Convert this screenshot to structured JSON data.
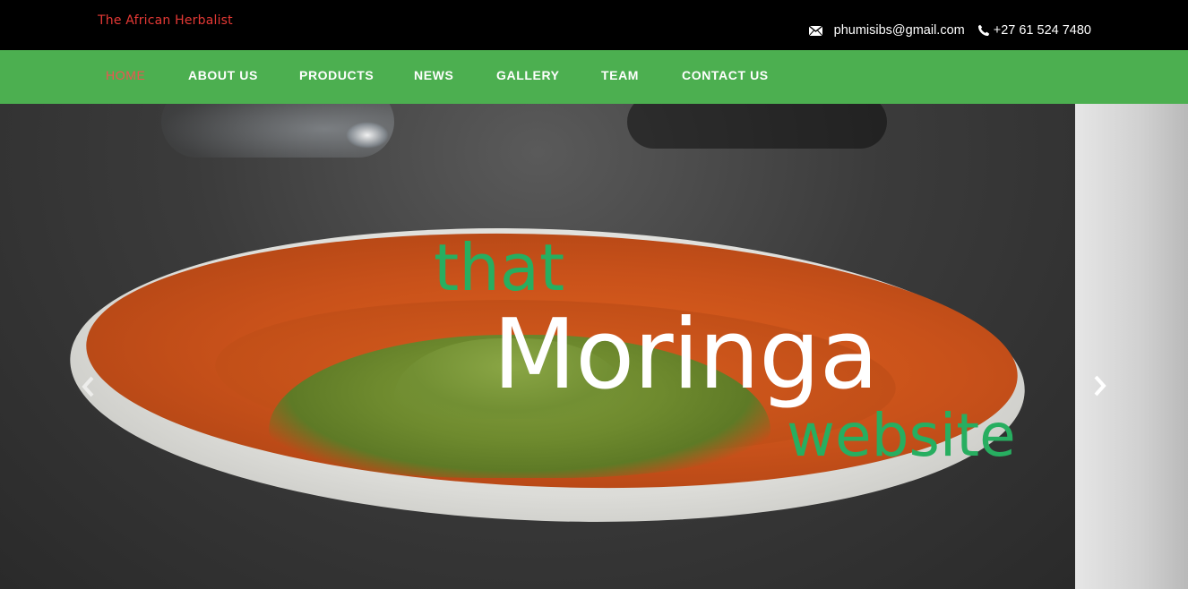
{
  "header": {
    "brand": "The African Herbalist",
    "email": "phumisibs@gmail.com",
    "phone": "+27 61 524 7480",
    "icons": {
      "email": "envelope-icon",
      "phone": "phone-icon"
    }
  },
  "nav": {
    "items": [
      {
        "label": "HOME",
        "active": true
      },
      {
        "label": "ABOUT US"
      },
      {
        "label": "PRODUCTS"
      },
      {
        "label": "NEWS"
      },
      {
        "label": "GALLERY"
      },
      {
        "label": "TEAM"
      },
      {
        "label": "CONTACT US"
      }
    ]
  },
  "hero": {
    "line1": "that",
    "line2": "Moringa",
    "line3": "website",
    "controls": {
      "prev_icon": "chevron-left-icon",
      "next_icon": "chevron-right-icon"
    }
  },
  "colors": {
    "topbar": "#000000",
    "nav": "#4caf50",
    "brand": "#e53935",
    "active_nav": "#ef5350",
    "hero_accent": "#27ae60"
  }
}
